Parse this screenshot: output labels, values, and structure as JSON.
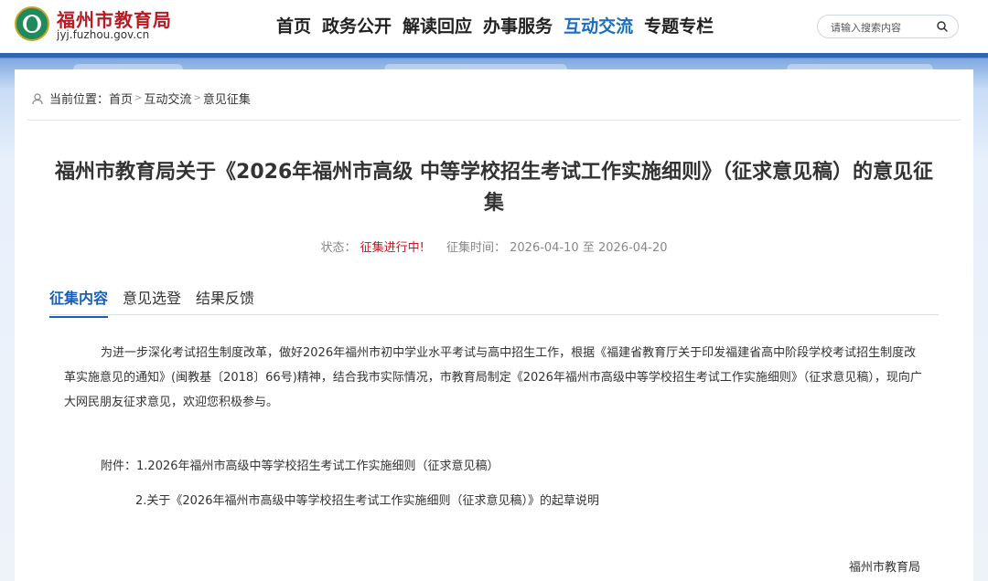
{
  "header": {
    "site_name": "福州市教育局",
    "site_domain": "jyj.fuzhou.gov.cn",
    "nav": [
      {
        "label": "首页",
        "active": false
      },
      {
        "label": "政务公开",
        "active": false
      },
      {
        "label": "解读回应",
        "active": false
      },
      {
        "label": "办事服务",
        "active": false
      },
      {
        "label": "互动交流",
        "active": true
      },
      {
        "label": "专题专栏",
        "active": false
      }
    ],
    "search_placeholder": "请输入搜索内容"
  },
  "breadcrumb": {
    "prefix": "当前位置：",
    "items": [
      "首页",
      "互动交流",
      "意见征集"
    ],
    "separator": ">"
  },
  "article": {
    "title": "福州市教育局关于《2026年福州市高级 中等学校招生考试工作实施细则》（征求意见稿）的意见征集",
    "status_label": "状态：",
    "status_value": "征集进行中!",
    "time_label": "征集时间：",
    "time_value": "2026-04-10 至 2026-04-20",
    "tabs": [
      "征集内容",
      "意见选登",
      "结果反馈"
    ],
    "active_tab": 0,
    "body": "为进一步深化考试招生制度改革，做好2026年福州市初中学业水平考试与高中招生工作，根据《福建省教育厅关于印发福建省高中阶段学校考试招生制度改革实施意见的通知》(闽教基〔2018〕66号)精神，结合我市实际情况，市教育局制定《2026年福州市高级中等学校招生考试工作实施细则》（征求意见稿），现向广大网民朋友征求意见，欢迎您积极参与。",
    "attachment_label": "附件：",
    "attachment_1": "1.2026年福州市高级中等学校招生考试工作实施细则（征求意见稿）",
    "attachment_2": "2.关于《2026年福州市高级中等学校招生考试工作实施细则（征求意见稿）》的起草说明",
    "signature": "福州市教育局"
  },
  "colors": {
    "brand_red": "#b81c22",
    "nav_active": "#1a6fc1",
    "tab_active": "#1a5fb4",
    "status_red": "#c8161d"
  }
}
